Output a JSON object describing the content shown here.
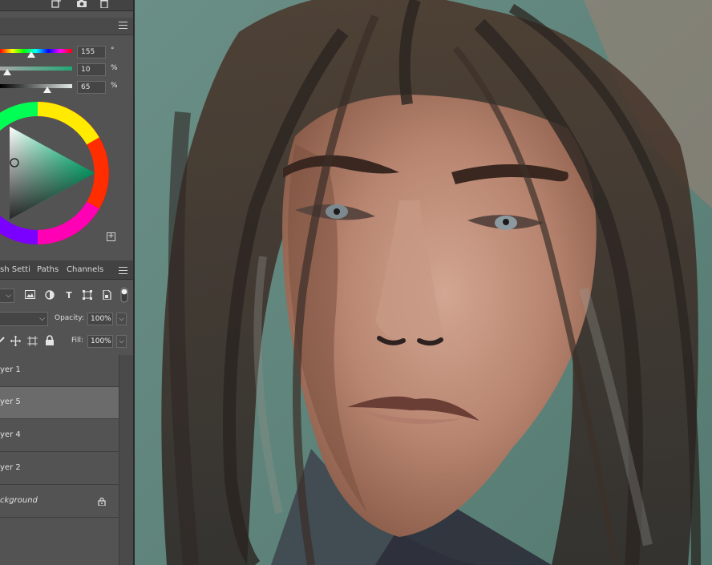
{
  "topbar": {
    "icons": [
      "new-layer-icon",
      "camera-icon",
      "trash-icon"
    ]
  },
  "color_panel": {
    "sliders": [
      {
        "name": "hue",
        "value": "155",
        "unit": "°",
        "level": 0.43
      },
      {
        "name": "saturation",
        "value": "10",
        "unit": "%",
        "level": 0.1
      },
      {
        "name": "brightness",
        "value": "65",
        "unit": "%",
        "level": 0.65
      }
    ],
    "accent_colors": {
      "hue_track": "rainbow",
      "sat_track": "#2fa579",
      "bright_track": "#dfe6e4"
    }
  },
  "tabs": [
    {
      "label": "sh Setti",
      "selected": false
    },
    {
      "label": "Paths",
      "selected": false
    },
    {
      "label": "Channels",
      "selected": false
    }
  ],
  "layers_panel": {
    "opacity_label": "Opacity:",
    "opacity_value": "100%",
    "fill_label": "Fill:",
    "fill_value": "100%",
    "filter_icons": [
      "image-filter-icon",
      "adjustment-filter-icon",
      "type-filter-icon",
      "shape-filter-icon",
      "smart-object-filter-icon"
    ],
    "lock_icons": [
      "lock-pixels-icon",
      "move-icon",
      "artboard-icon",
      "lock-icon"
    ],
    "layers": [
      {
        "name": "yer 1",
        "selected": false,
        "italic": false,
        "locked": false
      },
      {
        "name": "yer 5",
        "selected": true,
        "italic": false,
        "locked": false
      },
      {
        "name": "yer 4",
        "selected": false,
        "italic": false,
        "locked": false
      },
      {
        "name": "yer 2",
        "selected": false,
        "italic": false,
        "locked": false
      },
      {
        "name": "ckground",
        "selected": false,
        "italic": true,
        "locked": true
      }
    ]
  },
  "canvas": {
    "background": "#5d8279",
    "subject": "painted portrait"
  }
}
